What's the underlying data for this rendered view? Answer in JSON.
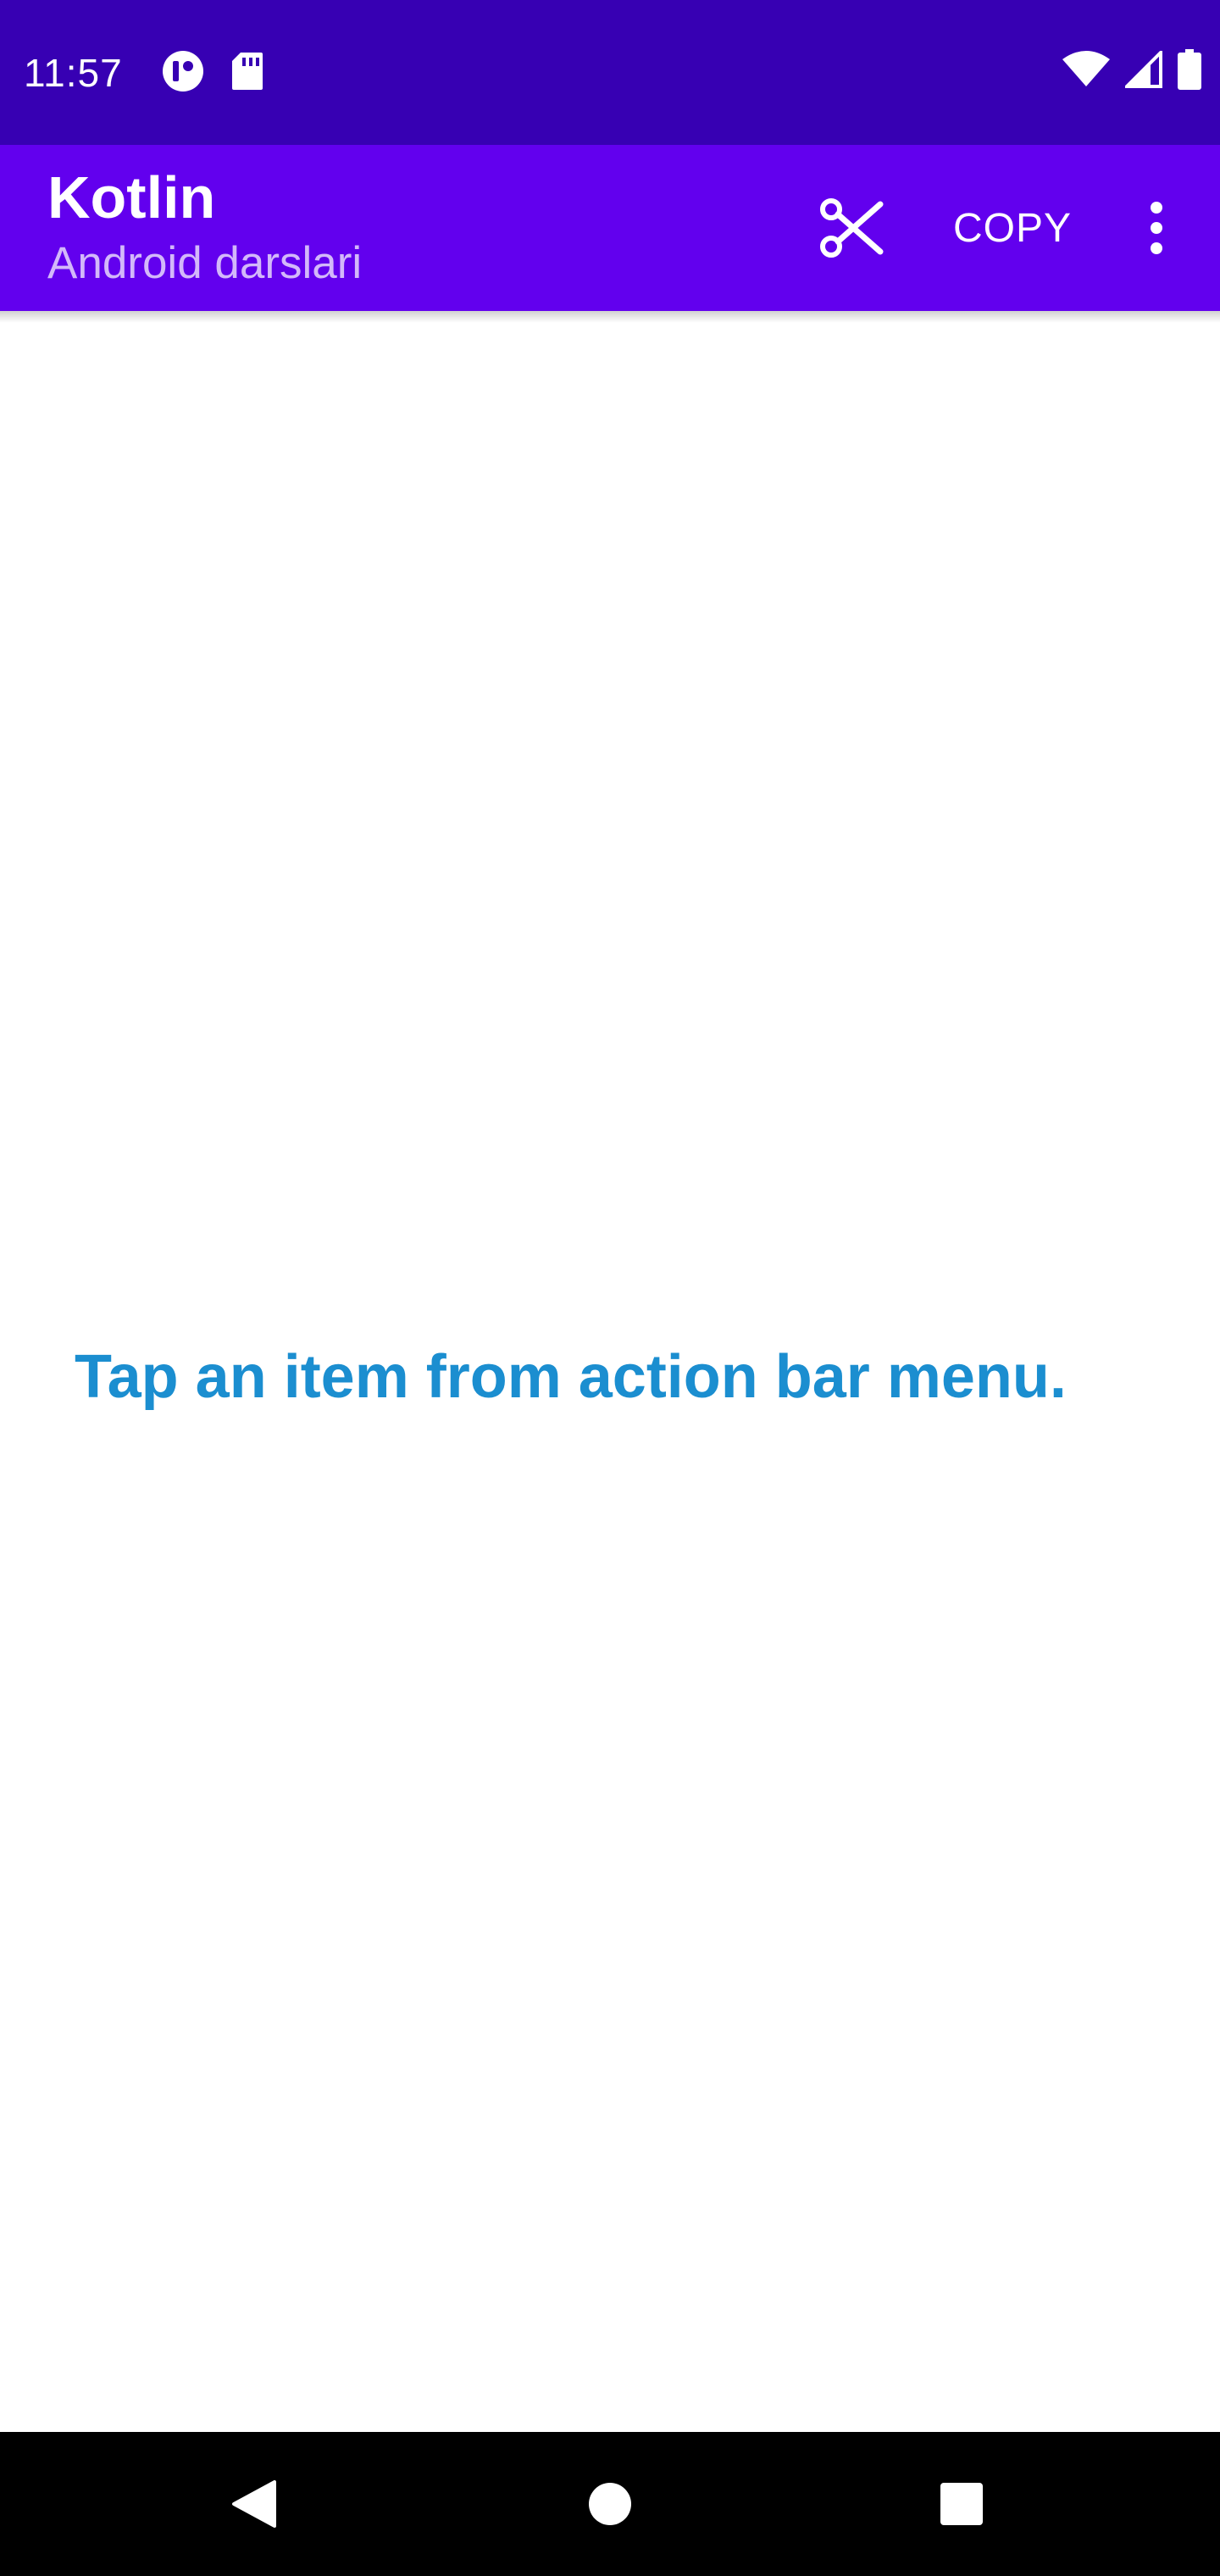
{
  "status_bar": {
    "time": "11:57",
    "left_icons": [
      "privacy-indicator-icon",
      "sd-card-icon"
    ],
    "right_icons": [
      "wifi-icon",
      "cell-signal-icon",
      "battery-icon"
    ]
  },
  "app_bar": {
    "title": "Kotlin",
    "subtitle": "Android darslari",
    "actions": {
      "cut_icon": "scissors-icon",
      "copy_label": "COPY",
      "overflow_icon": "more-vert-icon"
    },
    "background": "#6200ee"
  },
  "main": {
    "message": "Tap an item from action bar menu.",
    "message_color": "#1b8ed0"
  },
  "nav_bar": {
    "buttons": [
      "back-icon",
      "home-icon",
      "recents-icon"
    ]
  }
}
